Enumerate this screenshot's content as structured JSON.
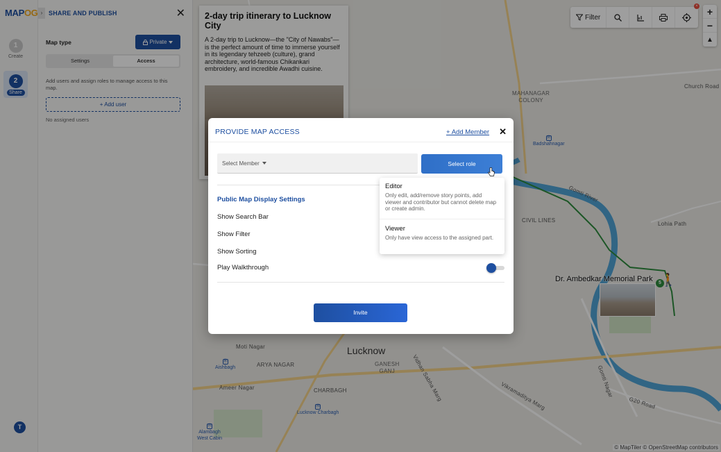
{
  "app": {
    "logo_main": "MAP",
    "logo_accent": "OG"
  },
  "rail": {
    "steps": [
      {
        "num": "1",
        "label": "Create"
      },
      {
        "num": "2",
        "label": "Share"
      }
    ],
    "avatar_initial": "T"
  },
  "panel": {
    "title": "SHARE AND PUBLISH",
    "collapse_glyph": "›",
    "close_glyph": "✕",
    "map_type_label": "Map type",
    "map_type_value": "Private",
    "tabs": [
      {
        "label": "Settings"
      },
      {
        "label": "Access"
      }
    ],
    "access_desc": "Add users and assign roles to manage access to this map.",
    "add_user_label": "+ Add user",
    "no_users_text": "No assigned users"
  },
  "story": {
    "title": "2-day trip itinerary to Lucknow City",
    "body": "A 2-day trip to Lucknow—the \"City of Nawabs\"—is the perfect amount of time to immerse yourself in its legendary tehzeeb (culture), grand architecture, world-famous Chikankari embroidery, and incredible Awadhi cuisine."
  },
  "map": {
    "toolbar": {
      "filter_label": "Filter"
    },
    "zoom": {
      "in": "+",
      "out": "−",
      "compass": "▲"
    },
    "labels": {
      "mahanagar": "MAHANAGAR\nCOLONY",
      "civil_lines": "CIVIL LINES",
      "church_road": "Church Road",
      "lohia_path": "Lohia Path",
      "gomti_river": "Gomti River",
      "lucknow": "Lucknow",
      "ganesh_ganj": "GANESH\nGANJ",
      "arya_nagar": "ARYA NAGAR",
      "moti_nagar": "Moti Nagar",
      "ameer_nagar": "Ameer Nagar",
      "charbagh": "CHARBAGH",
      "vikramaditya": "Vikramaditya Marg",
      "g20_road": "G20 Road",
      "vidhan": "Vidhan Sabha Marg",
      "gomti_nagar": "Gomti Nagar"
    },
    "metro": {
      "badshahnagar": "Badshahnagar",
      "aishbagh": "Aishbagh",
      "lucknow_charbagh": "Lucknow Charbagh",
      "alambagh": "Alambagh\nWest Cabin"
    },
    "park_label": "Dr. Ambedkar Memorial Park",
    "pin_text": "5",
    "notif": "×",
    "attribution": "© MapTiler © OpenStreetMap contributors"
  },
  "modal": {
    "title": "PROVIDE MAP ACCESS",
    "add_member": "+ Add Member",
    "close_glyph": "✕",
    "member_placeholder": "Select Member",
    "select_role_label": "Select role",
    "settings_title": "Public Map Display Settings",
    "settings": [
      {
        "label": "Show Search Bar"
      },
      {
        "label": "Show Filter"
      },
      {
        "label": "Show Sorting"
      },
      {
        "label": "Play Walkthrough"
      }
    ],
    "invite_label": "Invite"
  },
  "roles": [
    {
      "name": "Editor",
      "desc": "Only edit, add/remove story points, add viewer and contributor but cannot delete map or create admin."
    },
    {
      "name": "Viewer",
      "desc": "Only have view access to the assigned part."
    }
  ],
  "colors": {
    "brand": "#1e4fa0",
    "accent": "#f0a820",
    "river": "#4fa3d6",
    "route": "#2e8b3e"
  }
}
